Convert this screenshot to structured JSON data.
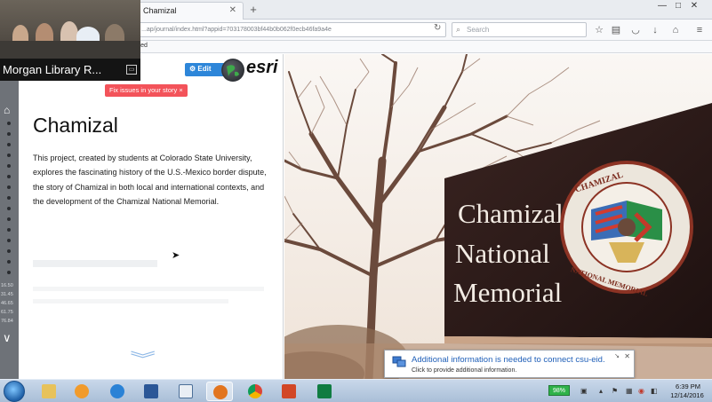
{
  "webcam": {
    "caption": "Morgan Library R..."
  },
  "browser": {
    "tab_title": "Chamizal",
    "url": "...ap/journal/index.html?appid=703178003bf44b0b062f0ecb46fa9a4e",
    "search_placeholder": "Search",
    "bookmarks_text": "arted"
  },
  "story": {
    "edit_label": "Edit",
    "brand": "esri",
    "issue_badge": "Fix issues in your story ×",
    "title": "Chamizal",
    "body": "This project, created by students at Colorado State University, explores the fascinating history of the U.S.-Mexico border dispute, the story of Chamizal in both local and international contexts, and the development of the Chamizal National Memorial."
  },
  "leftnav": {
    "coords": [
      "16.50",
      "31.45",
      "46.65",
      "61.75",
      "76.84"
    ]
  },
  "photo": {
    "sign_line1": "Chamizal",
    "sign_line2": "National",
    "sign_line3": "Memorial",
    "seal_top": "CHAMIZAL",
    "seal_bottom": "NATIONAL MEMORIAL"
  },
  "notification": {
    "title": "Additional information is needed to connect csu-eid.",
    "subtitle": "Click to provide additional information."
  },
  "taskbar": {
    "battery": "98%",
    "time": "6:39 PM",
    "date": "12/14/2016"
  },
  "colors": {
    "accent": "#2d86d9",
    "badge": "#f3535a",
    "leftnav": "#6e7278",
    "sign_board": "#2a1a18"
  }
}
